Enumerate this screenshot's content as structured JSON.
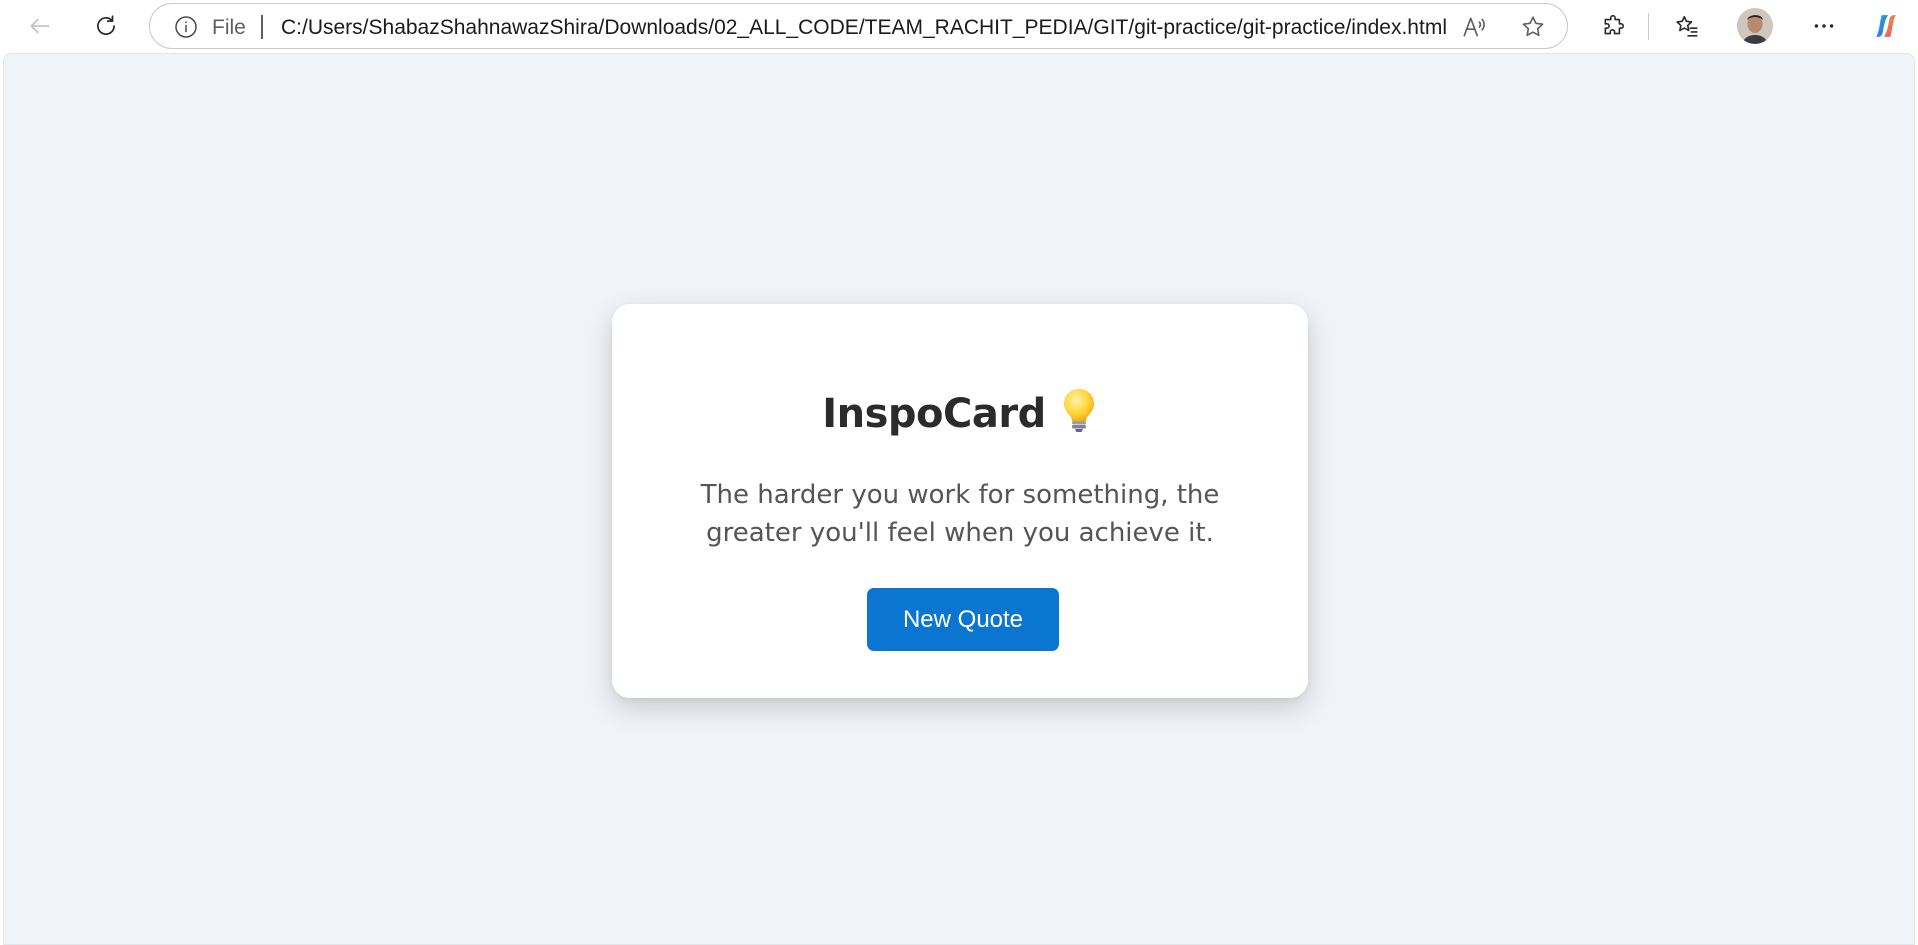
{
  "browser": {
    "address_bar": {
      "scheme_label": "File",
      "url": "C:/Users/ShabazShahnawazShira/Downloads/02_ALL_CODE/TEAM_RACHIT_PEDIA/GIT/git-practice/git-practice/index.html"
    },
    "icons": {
      "back": "back-arrow-icon",
      "reload": "reload-icon",
      "info": "info-icon",
      "read_aloud": "read-aloud-icon",
      "favorite": "star-icon",
      "extensions": "puzzle-icon",
      "favorites": "favorites-icon",
      "profile": "avatar",
      "more": "more-icon",
      "copilot": "copilot-icon"
    }
  },
  "page": {
    "title": "InspoCard",
    "title_icon": "lightbulb-icon",
    "quote": "The harder you work for something, the greater you'll feel when you achieve it.",
    "button_label": "New Quote"
  },
  "colors": {
    "page_background": "#f0f3f7",
    "card_background": "#ffffff",
    "button_background": "#0b76d1",
    "title_text": "#2b2b2b",
    "quote_text": "#555555"
  }
}
